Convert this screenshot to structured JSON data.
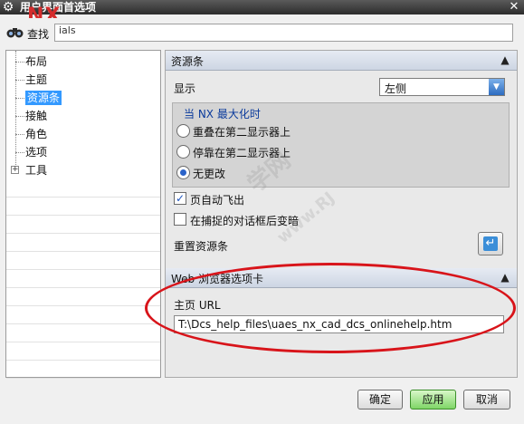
{
  "window": {
    "title": "用户界面首选项",
    "close_glyph": "✕",
    "watermark": "NX"
  },
  "search": {
    "label": "查找",
    "value": "ials"
  },
  "tree": {
    "items": [
      {
        "label": "布局"
      },
      {
        "label": "主题"
      },
      {
        "label": "资源条",
        "selected": true
      },
      {
        "label": "接触"
      },
      {
        "label": "角色"
      },
      {
        "label": "选项"
      },
      {
        "label": "工具",
        "expandable": true
      }
    ]
  },
  "resource_bar": {
    "section_title": "资源条",
    "display_label": "显示",
    "display_value": "左侧",
    "group_title": "当 NX 最大化时",
    "radios": [
      {
        "label": "重叠在第二显示器上",
        "checked": false
      },
      {
        "label": "停靠在第二显示器上",
        "checked": false
      },
      {
        "label": "无更改",
        "checked": true
      }
    ],
    "checkboxes": [
      {
        "label": "页自动飞出",
        "checked": true
      },
      {
        "label": "在捕捉的对话框后变暗",
        "checked": false
      }
    ],
    "reset_label": "重置资源条"
  },
  "web_browser": {
    "section_title": "Web 浏览器选项卡",
    "homepage_label": "主页 URL",
    "homepage_value": "T:\\Dcs_help_files\\uaes_nx_cad_dcs_onlinehelp.htm"
  },
  "buttons": {
    "ok": "确定",
    "apply": "应用",
    "cancel": "取消"
  },
  "watermarks": {
    "site_cn": "学网",
    "site_url": "www.RJ"
  }
}
